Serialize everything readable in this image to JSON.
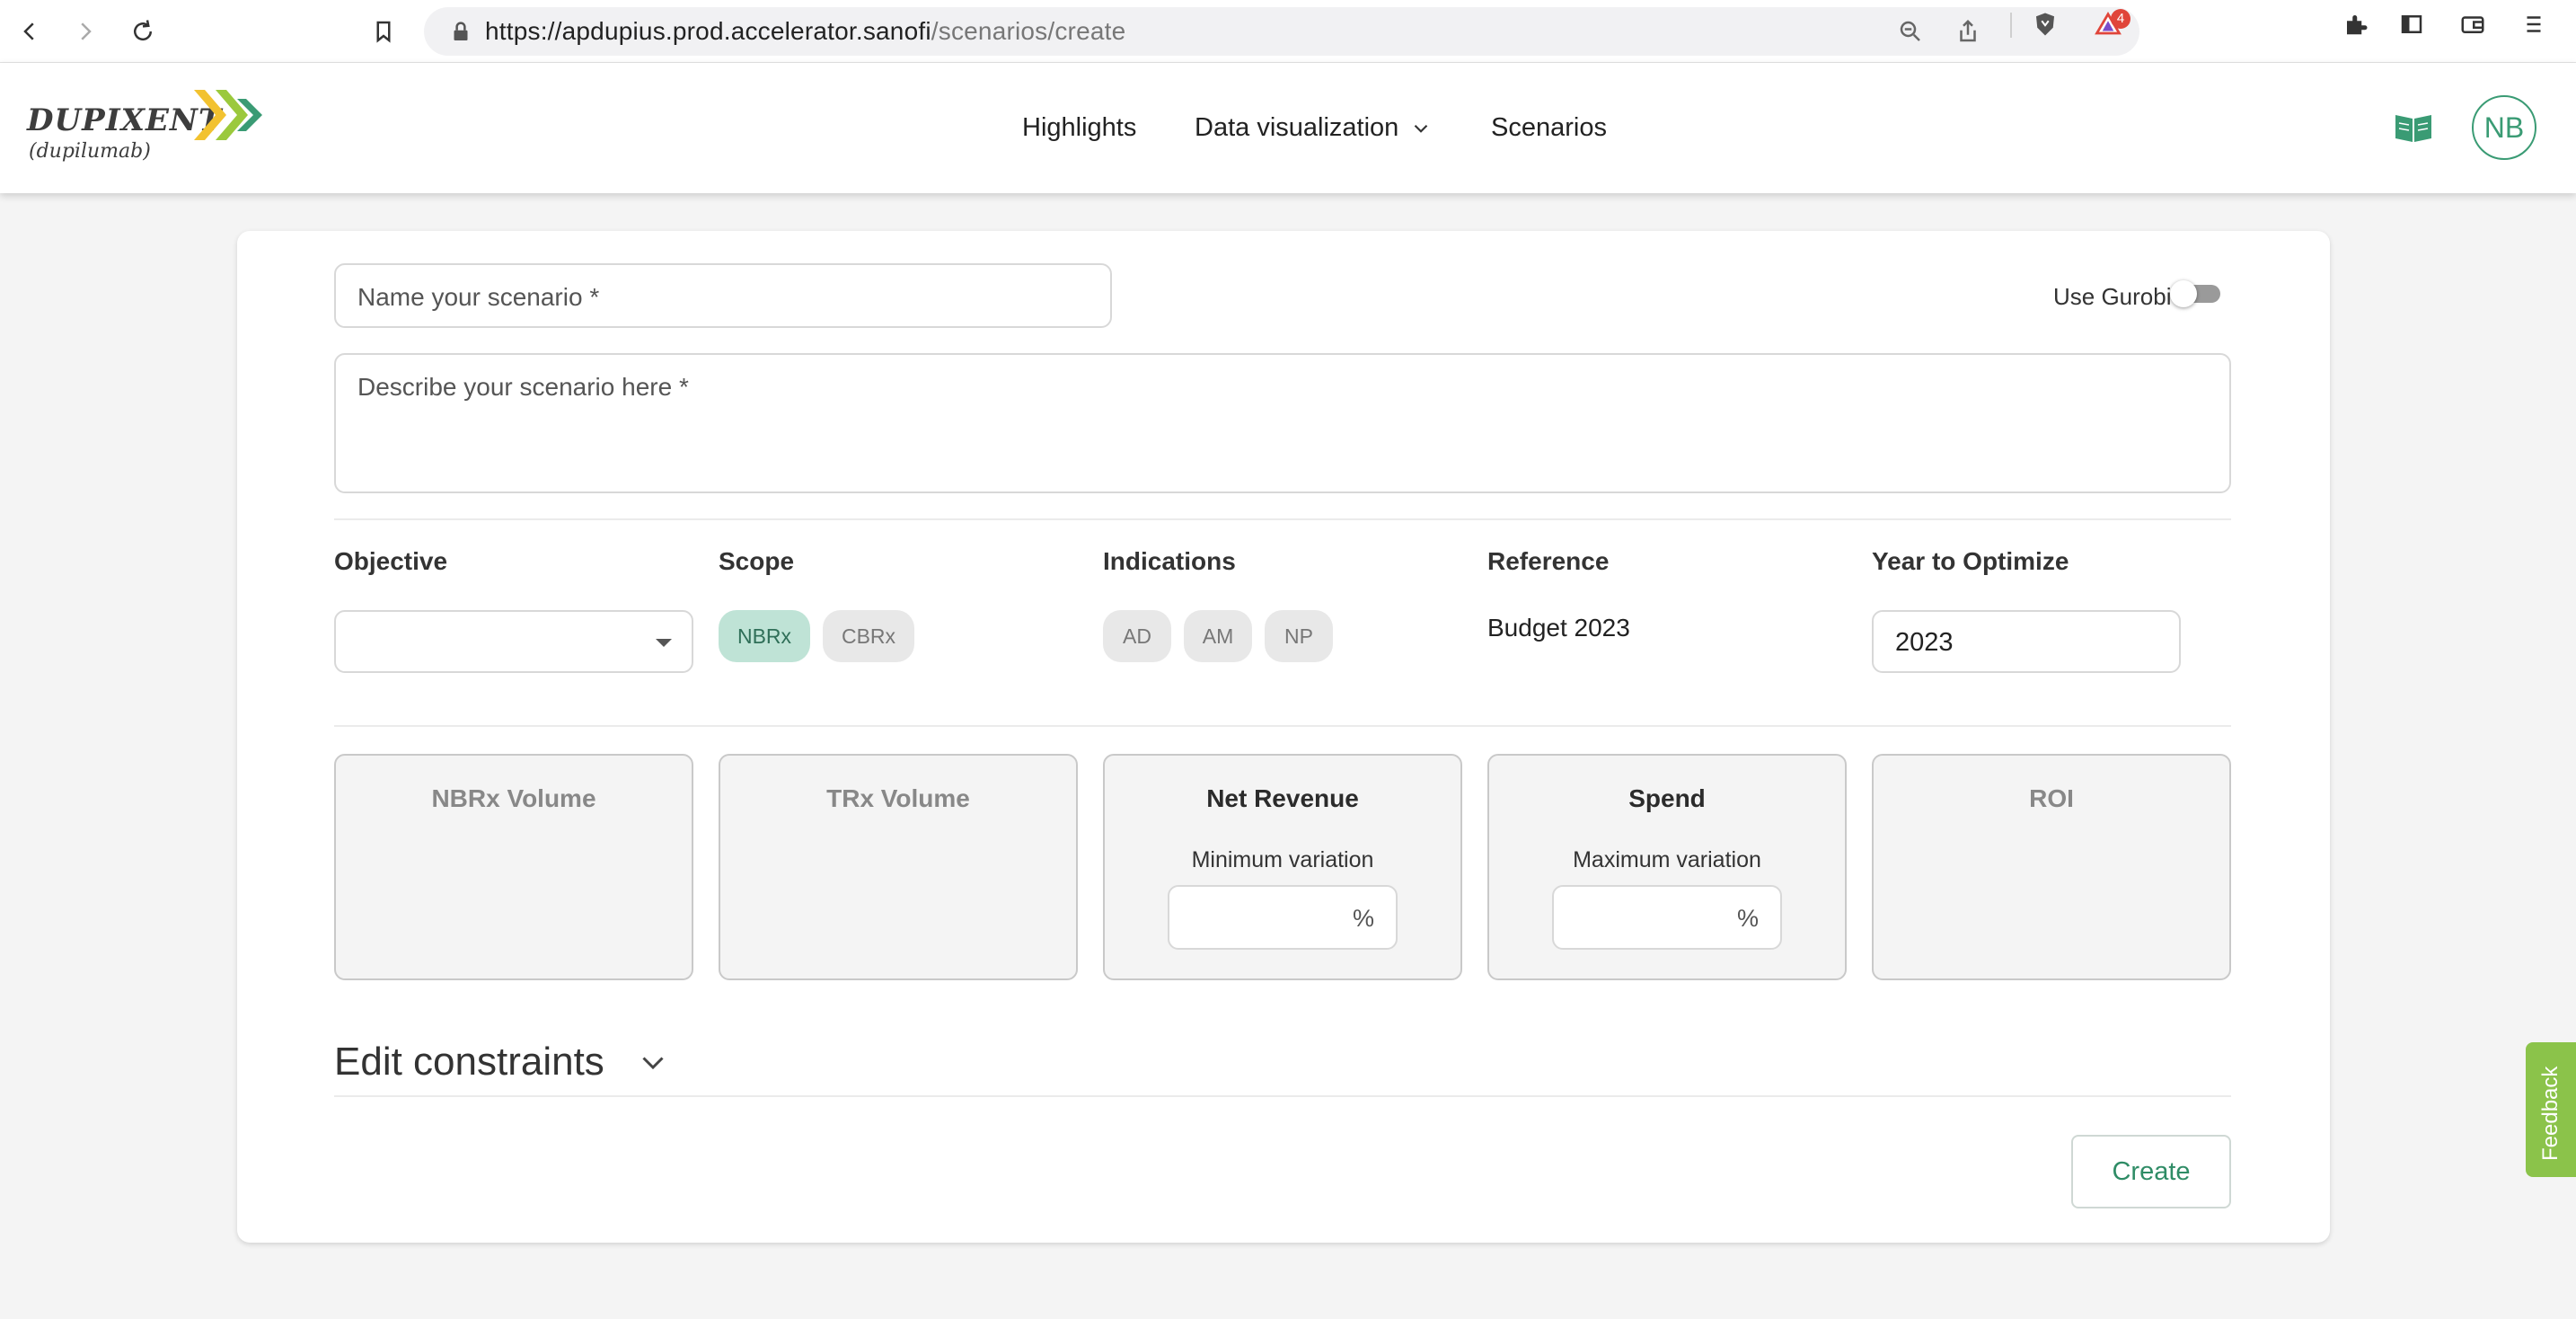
{
  "browser": {
    "url_host": "https://apdupius.prod.accelerator.sanofi",
    "url_path": "/scenarios/create",
    "notification_count": "4"
  },
  "header": {
    "logo_brand": "DUPIXENT",
    "logo_sub": "(dupilumab)",
    "nav": {
      "highlights": "Highlights",
      "data_visualization": "Data visualization",
      "scenarios": "Scenarios"
    },
    "avatar_initials": "NB"
  },
  "form": {
    "name_placeholder": "Name your scenario *",
    "description_placeholder": "Describe your scenario here *",
    "gurobi_label": "Use Gurobi",
    "labels": {
      "objective": "Objective",
      "scope": "Scope",
      "indications": "Indications",
      "reference": "Reference",
      "year": "Year to Optimize"
    },
    "scope_chips": [
      "NBRx",
      "CBRx"
    ],
    "indication_chips": [
      "AD",
      "AM",
      "NP"
    ],
    "reference_value": "Budget 2023",
    "year_value": "2023"
  },
  "kpis": [
    {
      "title": "NBRx Volume"
    },
    {
      "title": "TRx Volume"
    },
    {
      "title": "Net Revenue",
      "subtitle": "Minimum variation",
      "unit": "%"
    },
    {
      "title": "Spend",
      "subtitle": "Maximum variation",
      "unit": "%"
    },
    {
      "title": "ROI"
    }
  ],
  "constraints_label": "Edit constraints",
  "create_label": "Create",
  "feedback_label": "Feedback",
  "colors": {
    "accent": "#3a9b74",
    "chip_active": "#bfe3d6",
    "feedback": "#8bc34a"
  }
}
